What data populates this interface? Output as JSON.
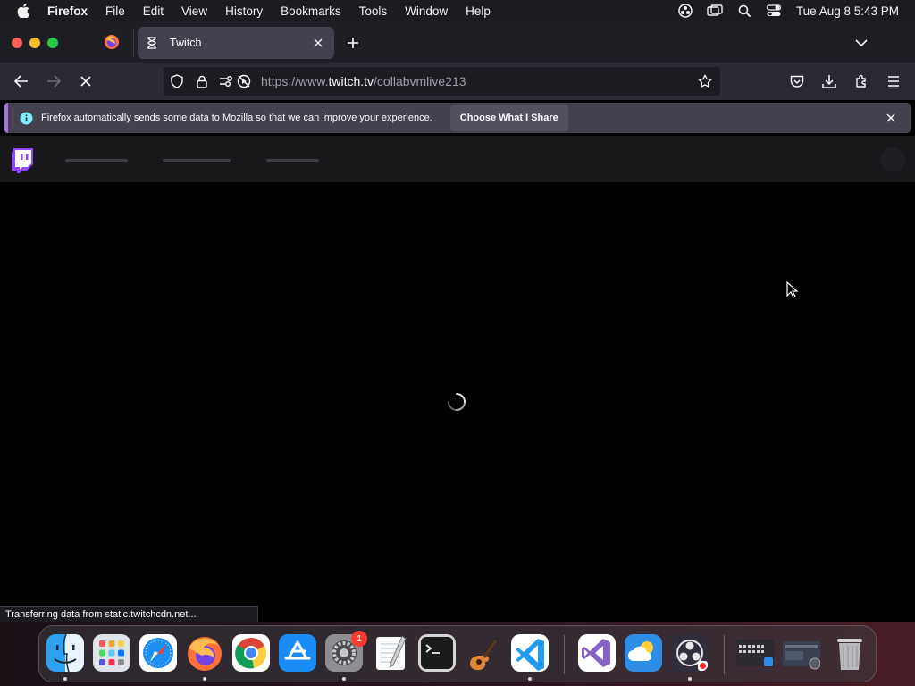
{
  "menubar": {
    "app_name": "Firefox",
    "menus": [
      "File",
      "Edit",
      "View",
      "History",
      "Bookmarks",
      "Tools",
      "Window",
      "Help"
    ],
    "clock": "Tue Aug 8  5:43 PM"
  },
  "tabs": [
    {
      "title": "Twitch",
      "icon": "hourglass-loading-icon",
      "active": true
    }
  ],
  "urlbar": {
    "url_prefix": "https://www.",
    "url_domain": "twitch.tv",
    "url_path": "/collabvmlive213"
  },
  "notification": {
    "message": "Firefox automatically sends some data to Mozilla so that we can improve your experience.",
    "button_label": "Choose What I Share"
  },
  "page": {
    "site": "Twitch",
    "state": "loading"
  },
  "statusbar": {
    "text": "Transferring data from static.twitchcdn.net..."
  },
  "dock": {
    "apps": [
      {
        "name": "Finder",
        "running": true
      },
      {
        "name": "Launchpad",
        "running": false
      },
      {
        "name": "Safari",
        "running": false
      },
      {
        "name": "Firefox",
        "running": true
      },
      {
        "name": "Google Chrome",
        "running": false
      },
      {
        "name": "App Store",
        "running": false
      },
      {
        "name": "System Settings",
        "running": true,
        "badge": "1"
      },
      {
        "name": "TextEdit",
        "running": false
      },
      {
        "name": "Terminal",
        "running": false
      },
      {
        "name": "GarageBand",
        "running": false
      },
      {
        "name": "Visual Studio Code",
        "running": true
      },
      {
        "name": "Visual Studio",
        "running": false
      },
      {
        "name": "Weather",
        "running": false
      },
      {
        "name": "OBS",
        "running": true
      }
    ]
  },
  "colors": {
    "twitch_purple": "#9146ff",
    "notification_accent": "#a374e0",
    "toolbar": "#2b2a33",
    "tab_active": "#42414d"
  }
}
